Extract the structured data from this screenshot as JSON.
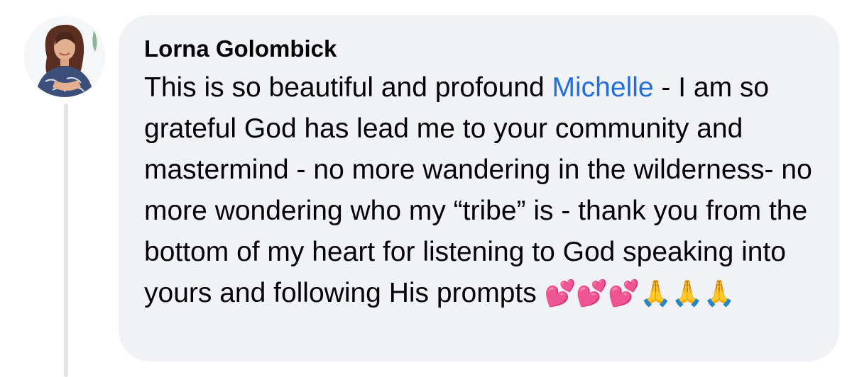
{
  "comment": {
    "author": "Lorna Golombick",
    "text_before": "This is so beautiful and profound ",
    "mention": "Michelle",
    "text_after": " - I am so grateful God has lead me to your community and mastermind - no more wandering in the wilderness- no more wondering who my “tribe” is - thank you from the bottom of my heart for listening to God speaking into yours and following His prompts ",
    "emojis": [
      "💕",
      "💕",
      "💕",
      "🙏",
      "🙏",
      "🙏"
    ]
  },
  "colors": {
    "bubble_background": "#f0f2f5",
    "mention_link": "#216fdb",
    "text": "#050505",
    "thread_line": "#e2e4e8"
  },
  "icons": {
    "avatar": "profile-photo",
    "emoji_heart": "two-hearts-emoji",
    "emoji_pray": "folded-hands-emoji"
  }
}
